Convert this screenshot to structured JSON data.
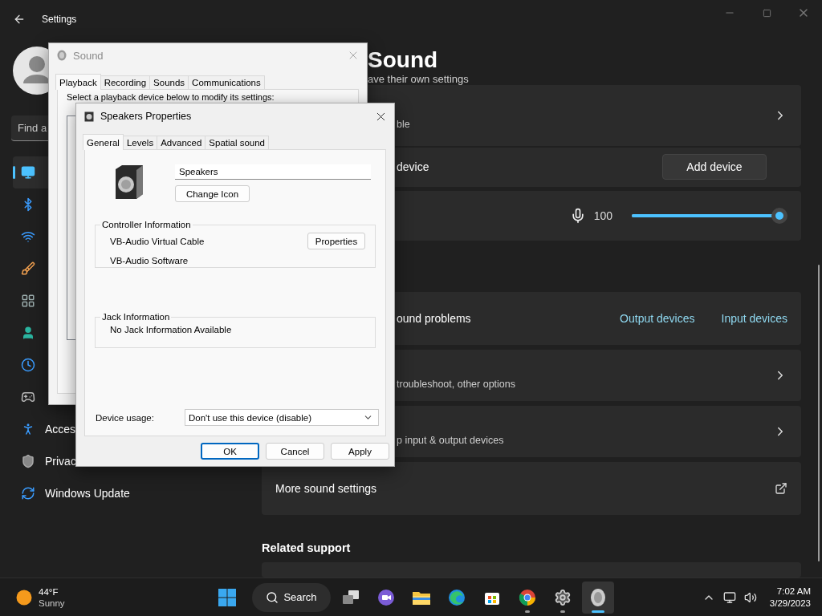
{
  "settings": {
    "title": "Settings",
    "search": {
      "placeholder": "Find a"
    },
    "sidebar": {
      "items": [
        {
          "selected": true
        },
        {
          "selected": false
        },
        {
          "selected": false
        },
        {
          "selected": false
        },
        {
          "selected": false
        },
        {
          "selected": false
        },
        {
          "selected": false
        },
        {
          "selected": false
        },
        {
          "label": "Acces",
          "selected": false
        },
        {
          "label": "Privac",
          "selected": false
        },
        {
          "label": "Windows Update",
          "selected": false
        }
      ]
    },
    "page": {
      "heading": "Sound",
      "description": "ave their own settings",
      "cards": [
        {
          "kind": "nav",
          "subtitle": "ble"
        },
        {
          "kind": "button",
          "title": "device",
          "button": "Add device"
        },
        {
          "kind": "slider",
          "reading": "100",
          "level": 1.0
        },
        {
          "kind": "links",
          "title": "ound problems",
          "links": [
            "Output devices",
            "Input devices"
          ]
        },
        {
          "kind": "nav",
          "subtitle": "troubleshoot, other options"
        },
        {
          "kind": "nav",
          "subtitle": "p input & output devices"
        },
        {
          "kind": "external",
          "title": "More sound settings"
        }
      ],
      "related_heading": "Related support"
    }
  },
  "sound_dialog": {
    "title": "Sound",
    "tabs": [
      {
        "label": "Playback",
        "selected": true
      },
      {
        "label": "Recording",
        "selected": false
      },
      {
        "label": "Sounds",
        "selected": false
      },
      {
        "label": "Communications",
        "selected": false
      }
    ],
    "instruction": "Select a playback device below to modify its settings:"
  },
  "properties_dialog": {
    "title": "Speakers Properties",
    "tabs": [
      {
        "label": "General",
        "selected": true
      },
      {
        "label": "Levels",
        "selected": false
      },
      {
        "label": "Advanced",
        "selected": false
      },
      {
        "label": "Spatial sound",
        "selected": false
      }
    ],
    "device_name": "Speakers",
    "change_icon": "Change Icon",
    "controller": {
      "legend": "Controller Information",
      "name": "VB-Audio Virtual Cable",
      "vendor": "VB-Audio Software",
      "button": "Properties"
    },
    "jack": {
      "legend": "Jack Information",
      "text": "No Jack Information Available"
    },
    "usage": {
      "label": "Device usage:",
      "value": "Don't use this device (disable)"
    },
    "buttons": [
      {
        "label": "OK",
        "default": true
      },
      {
        "label": "Cancel",
        "default": false
      },
      {
        "label": "Apply",
        "default": false
      }
    ]
  },
  "taskbar": {
    "weather": {
      "temperature": "44°F",
      "condition": "Sunny"
    },
    "search": "Search",
    "apps": [
      {
        "running": false,
        "active": false
      },
      {
        "running": false,
        "active": false
      },
      {
        "running": false,
        "active": false
      },
      {
        "running": false,
        "active": false
      },
      {
        "running": false,
        "active": false
      },
      {
        "running": true,
        "active": false
      },
      {
        "running": true,
        "active": false
      },
      {
        "running": true,
        "active": true
      }
    ],
    "time": "7:02 AM",
    "date": "3/29/2023"
  }
}
